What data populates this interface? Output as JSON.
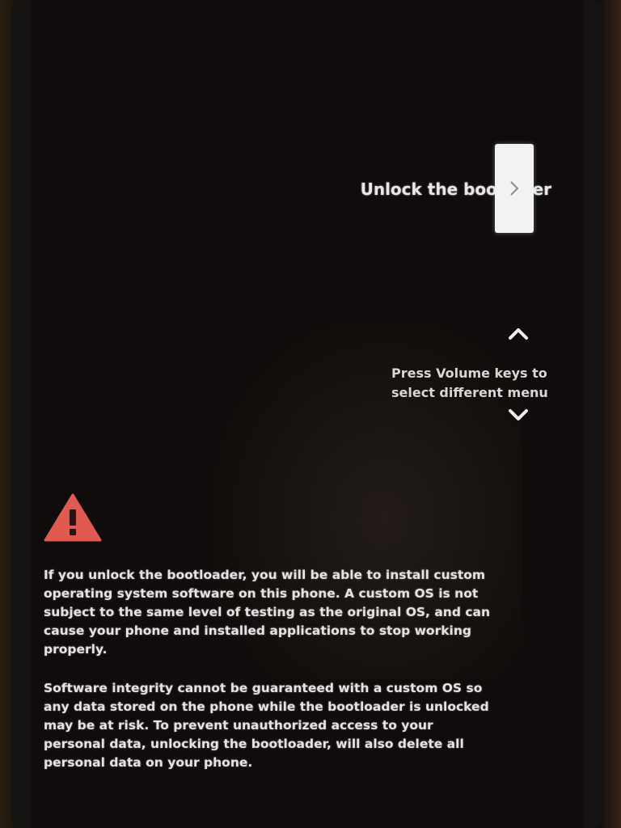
{
  "menu": {
    "label": "Unlock the bootloaer",
    "icon": "chevron-right-icon"
  },
  "volume_hint": {
    "line1": "Press Volume keys to",
    "line2": "select different menu",
    "up_icon": "chevron-up-icon",
    "down_icon": "chevron-down-icon"
  },
  "warning": {
    "icon": "warning-triangle-icon",
    "icon_color": "#e05a52",
    "paragraph1": "If you unlock the bootloader, you will be able to install custom operating system software on this phone. A custom OS is not subject to the same level of testing as the original OS, and can cause your phone and installed applications to stop working properly.",
    "paragraph2": "Software integrity cannot be guaranteed with a custom OS so any data stored on the phone while the bootloader is unlocked may be at risk. To prevent unauthorized access to your personal data, unlocking the bootloader, will also delete all personal data on your phone."
  }
}
